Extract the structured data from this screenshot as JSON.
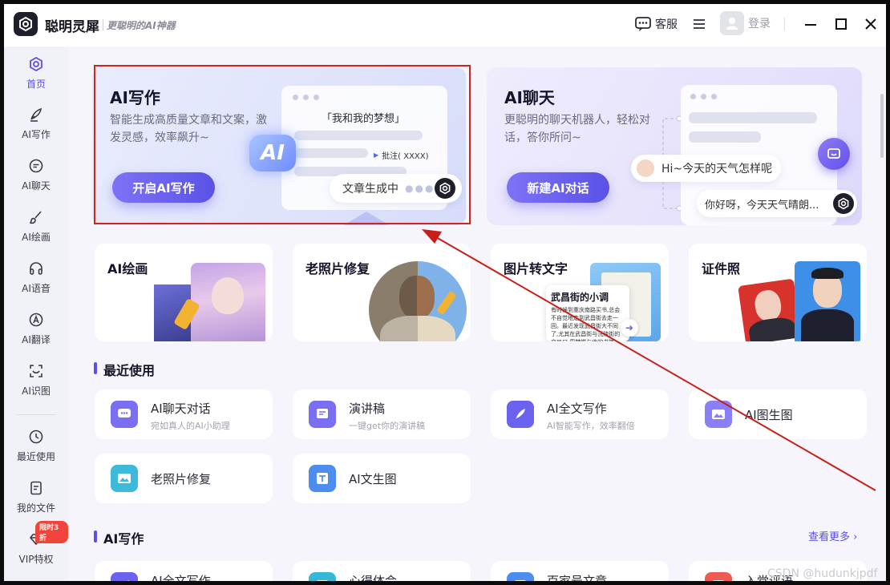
{
  "app": {
    "name": "聪明灵犀",
    "slogan": "更聪明的AI神器"
  },
  "titlebar": {
    "service_label": "客服",
    "login_label": "登录"
  },
  "sidebar": {
    "items": [
      {
        "label": "首页",
        "icon": "home-icon",
        "active": true
      },
      {
        "label": "AI写作",
        "icon": "pen-icon"
      },
      {
        "label": "AI聊天",
        "icon": "chat-icon"
      },
      {
        "label": "AI绘画",
        "icon": "brush-icon"
      },
      {
        "label": "AI语音",
        "icon": "headphones-icon"
      },
      {
        "label": "AI翻译",
        "icon": "translate-icon"
      },
      {
        "label": "AI识图",
        "icon": "scan-icon"
      },
      {
        "label": "最近使用",
        "icon": "clock-icon"
      },
      {
        "label": "我的文件",
        "icon": "file-icon"
      },
      {
        "label": "VIP特权",
        "icon": "diamond-icon"
      }
    ],
    "vip_badge": "限时3折"
  },
  "hero": {
    "write": {
      "title": "AI写作",
      "desc": "智能生成高质量文章和文案，激发灵感，效率飙升~",
      "button": "开启AI写作",
      "doc_title": "「我和我的梦想」",
      "annotation": "批注( XXXX)",
      "ai_badge": "AI",
      "status": "文章生成中"
    },
    "chat": {
      "title": "AI聊天",
      "desc": "更聪明的聊天机器人，轻松对话，答你所问~",
      "button": "新建AI对话",
      "bubble_user": "Hi~今天的天气怎样呢",
      "bubble_bot": "你好呀，今天天气晴朗..."
    }
  },
  "features": [
    {
      "title": "AI绘画"
    },
    {
      "title": "老照片修复"
    },
    {
      "title": "图片转文字",
      "book_title": "武昌街的小调",
      "book_text": "有时候到重庆南路买书,总会不自觉地走到武昌街去走一回。最近发现武昌街大不同了,尤其在武昌街与沅陵街的交叉口,周梦蝶与他的书摊"
    },
    {
      "title": "证件照"
    }
  ],
  "recent": {
    "title": "最近使用",
    "items": [
      {
        "title": "AI聊天对话",
        "sub": "宛如真人的AI小助理",
        "color": "#7a6ef2"
      },
      {
        "title": "演讲稿",
        "sub": "一键get你的演讲稿",
        "color": "#7a6ef2"
      },
      {
        "title": "AI全文写作",
        "sub": "AI智能写作，效率翻倍",
        "color": "#6b62ef"
      },
      {
        "title": "AI图生图",
        "sub": "",
        "color": "#8a7ff4"
      },
      {
        "title": "老照片修复",
        "sub": "",
        "color": "#3dbad9"
      },
      {
        "title": "AI文生图",
        "sub": "",
        "color": "#4d8df0"
      }
    ]
  },
  "ai_write": {
    "title": "AI写作",
    "more": "查看更多",
    "items": [
      {
        "title": "AI全文写作",
        "color": "#6b62ef"
      },
      {
        "title": "心得体会",
        "color": "#37b8d8"
      },
      {
        "title": "百家号文章",
        "color": "#4d8df0"
      },
      {
        "title": "入党评语",
        "color": "#ef5b52"
      }
    ]
  },
  "watermark": "CSDN @hudunkjpdf"
}
